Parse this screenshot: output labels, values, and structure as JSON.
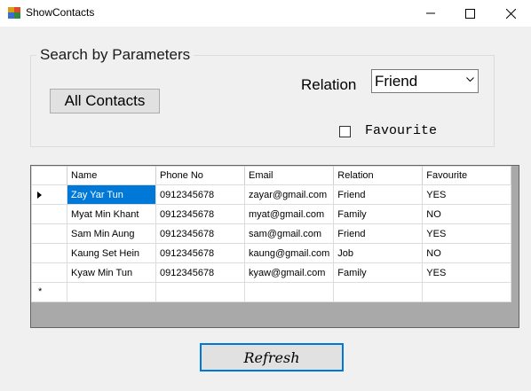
{
  "window": {
    "title": "ShowContacts",
    "controls": {
      "minimize": "minimize-icon",
      "maximize": "maximize-icon",
      "close": "close-icon"
    }
  },
  "search": {
    "group_title": "Search by Parameters",
    "all_contacts_label": "All Contacts",
    "relation_label": "Relation",
    "relation_value": "Friend",
    "favourite_label": "Favourite",
    "favourite_checked": false
  },
  "grid": {
    "columns": [
      "Name",
      "Phone No",
      "Email",
      "Relation",
      "Favourite"
    ],
    "rows": [
      {
        "name": "Zay Yar Tun",
        "phone": "0912345678",
        "email": "zayar@gmail.com",
        "relation": "Friend",
        "favourite": "YES"
      },
      {
        "name": "Myat Min Khant",
        "phone": "0912345678",
        "email": "myat@gmail.com",
        "relation": "Family",
        "favourite": "NO"
      },
      {
        "name": "Sam Min Aung",
        "phone": "0912345678",
        "email": "sam@gmail.com",
        "relation": "Friend",
        "favourite": "YES"
      },
      {
        "name": "Kaung Set Hein",
        "phone": "0912345678",
        "email": "kaung@gmail.com",
        "relation": "Job",
        "favourite": "NO"
      },
      {
        "name": "Kyaw Min Tun",
        "phone": "0912345678",
        "email": "kyaw@gmail.com",
        "relation": "Family",
        "favourite": "YES"
      }
    ],
    "selected_row": 0,
    "new_row_marker": "*"
  },
  "actions": {
    "refresh_label": "Refresh"
  },
  "colors": {
    "accent": "#0078d7",
    "grid_background": "#a9a9a9"
  }
}
